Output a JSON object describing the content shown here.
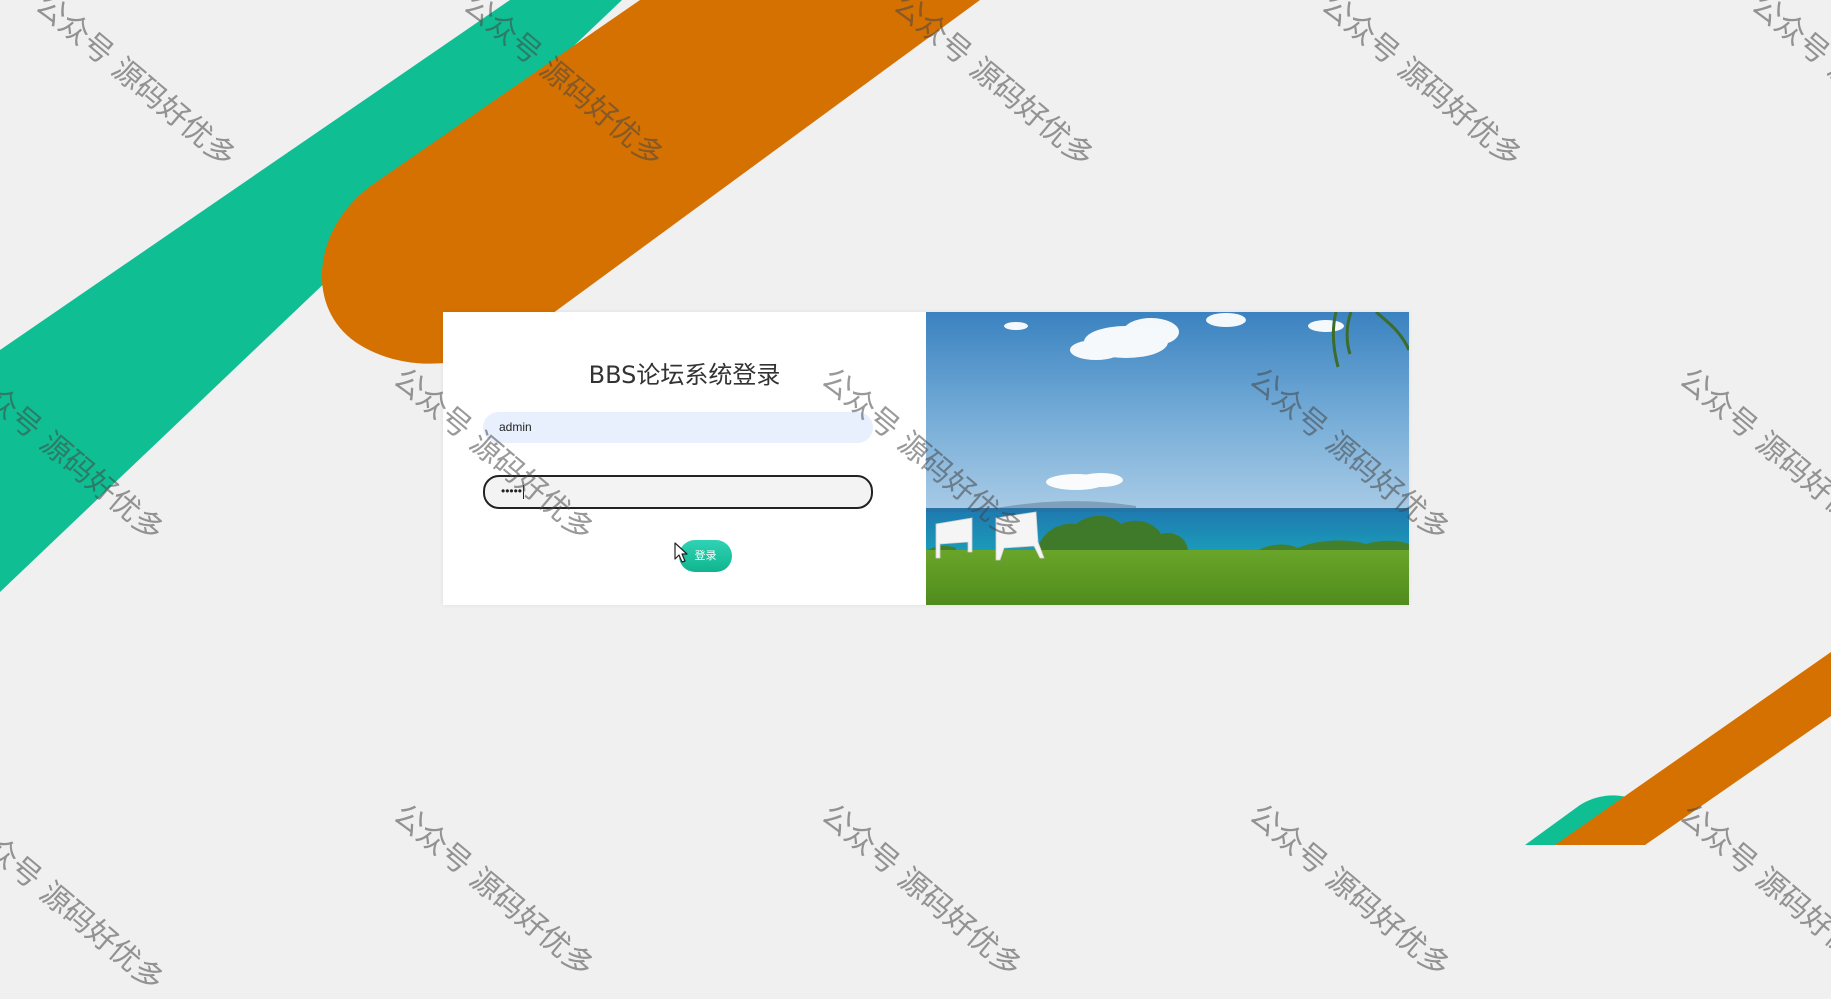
{
  "login": {
    "title": "BBS论坛系统登录",
    "username_value": "admin",
    "password_dots": "•••••",
    "submit_label": "登录"
  },
  "watermark": {
    "text": "公众号 源码好优多"
  },
  "colors": {
    "background": "#f0f0f0",
    "stripe_teal": "#0fbf93",
    "stripe_orange": "#d97300",
    "button": "#1cc3a0",
    "username_fill": "#e8f0fe"
  },
  "icons": {
    "cursor": "mouse-pointer-icon"
  }
}
